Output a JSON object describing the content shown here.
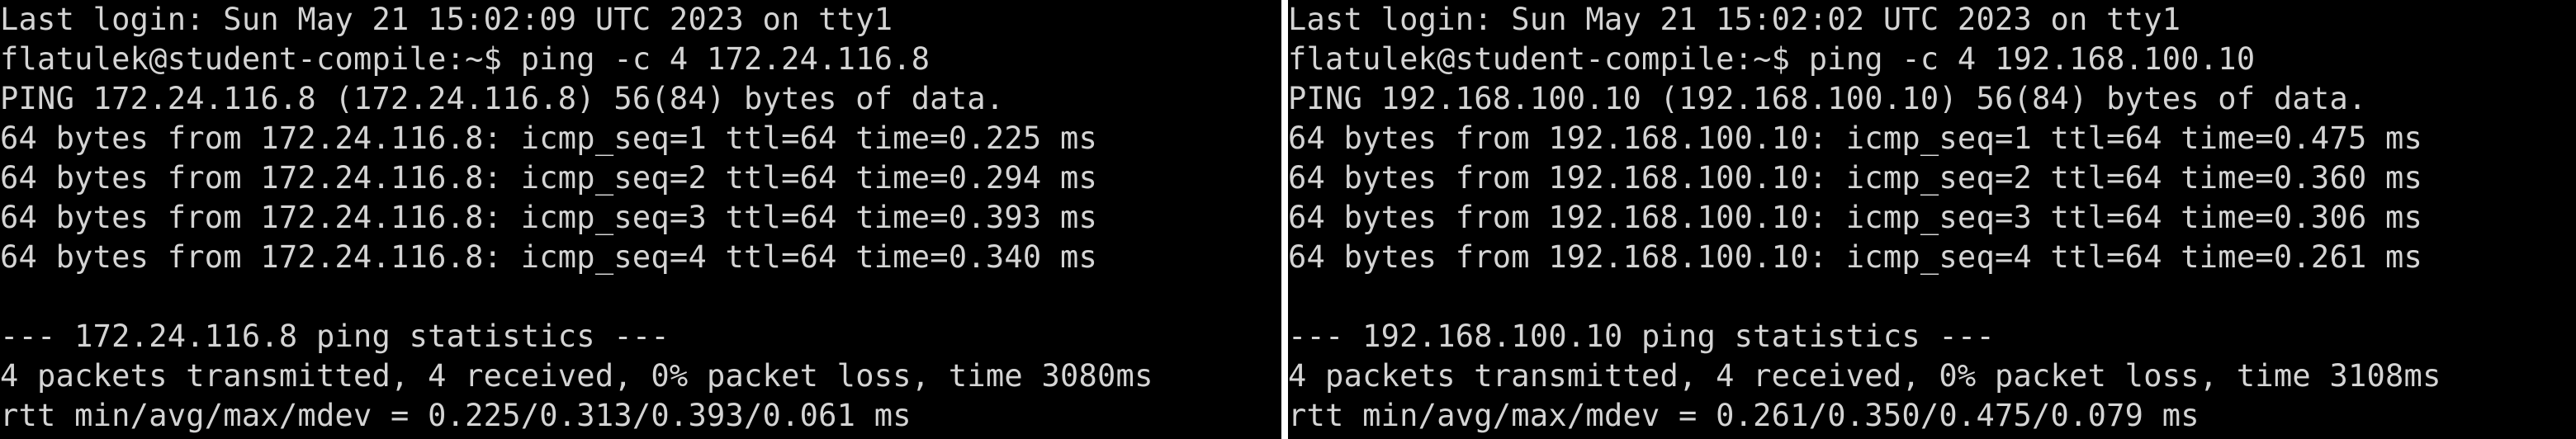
{
  "colors": {
    "background": "#000000",
    "text": "#d4d4d4",
    "divider": "#ffffff"
  },
  "left_terminal": {
    "lines": [
      "Last login: Sun May 21 15:02:09 UTC 2023 on tty1",
      "flatulek@student-compile:~$ ping -c 4 172.24.116.8",
      "PING 172.24.116.8 (172.24.116.8) 56(84) bytes of data.",
      "64 bytes from 172.24.116.8: icmp_seq=1 ttl=64 time=0.225 ms",
      "64 bytes from 172.24.116.8: icmp_seq=2 ttl=64 time=0.294 ms",
      "64 bytes from 172.24.116.8: icmp_seq=3 ttl=64 time=0.393 ms",
      "64 bytes from 172.24.116.8: icmp_seq=4 ttl=64 time=0.340 ms",
      "",
      "--- 172.24.116.8 ping statistics ---",
      "4 packets transmitted, 4 received, 0% packet loss, time 3080ms",
      "rtt min/avg/max/mdev = 0.225/0.313/0.393/0.061 ms"
    ]
  },
  "right_terminal": {
    "lines": [
      "Last login: Sun May 21 15:02:02 UTC 2023 on tty1",
      "flatulek@student-compile:~$ ping -c 4 192.168.100.10",
      "PING 192.168.100.10 (192.168.100.10) 56(84) bytes of data.",
      "64 bytes from 192.168.100.10: icmp_seq=1 ttl=64 time=0.475 ms",
      "64 bytes from 192.168.100.10: icmp_seq=2 ttl=64 time=0.360 ms",
      "64 bytes from 192.168.100.10: icmp_seq=3 ttl=64 time=0.306 ms",
      "64 bytes from 192.168.100.10: icmp_seq=4 ttl=64 time=0.261 ms",
      "",
      "--- 192.168.100.10 ping statistics ---",
      "4 packets transmitted, 4 received, 0% packet loss, time 3108ms",
      "rtt min/avg/max/mdev = 0.261/0.350/0.475/0.079 ms"
    ]
  }
}
